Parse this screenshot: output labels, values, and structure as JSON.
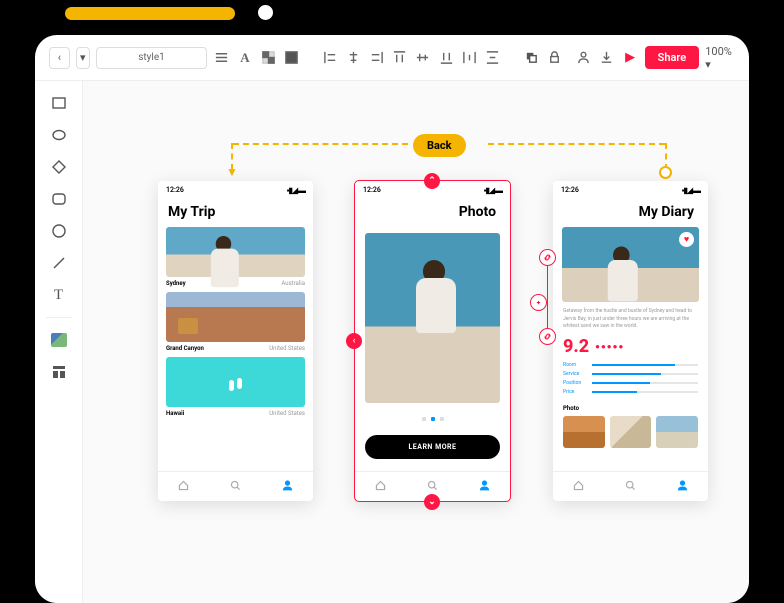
{
  "toolbar": {
    "style_selector": "style1",
    "share_label": "Share",
    "zoom_label": "100% ▾"
  },
  "flow": {
    "back_label": "Back"
  },
  "phones": {
    "status_time": "12:26",
    "trip": {
      "title": "My Trip",
      "items": [
        {
          "name": "Sydney",
          "country": "Australia"
        },
        {
          "name": "Grand Canyon",
          "country": "United States"
        },
        {
          "name": "Hawaii",
          "country": "United States"
        }
      ]
    },
    "photo": {
      "title": "Photo",
      "cta": "LEARN MORE"
    },
    "diary": {
      "title": "My Diary",
      "desc": "Getaway from the hustle and bustle of Sydney and head to Jervis Bay, in just under three hours we are arriving at the whitest sand we saw in the world.",
      "rating": "9.2",
      "rating_dots": "●●●●●",
      "bars": [
        {
          "label": "Room",
          "pct": 78
        },
        {
          "label": "Service",
          "pct": 65
        },
        {
          "label": "Position",
          "pct": 55
        },
        {
          "label": "Price",
          "pct": 42
        }
      ],
      "photo_label": "Photo"
    }
  }
}
